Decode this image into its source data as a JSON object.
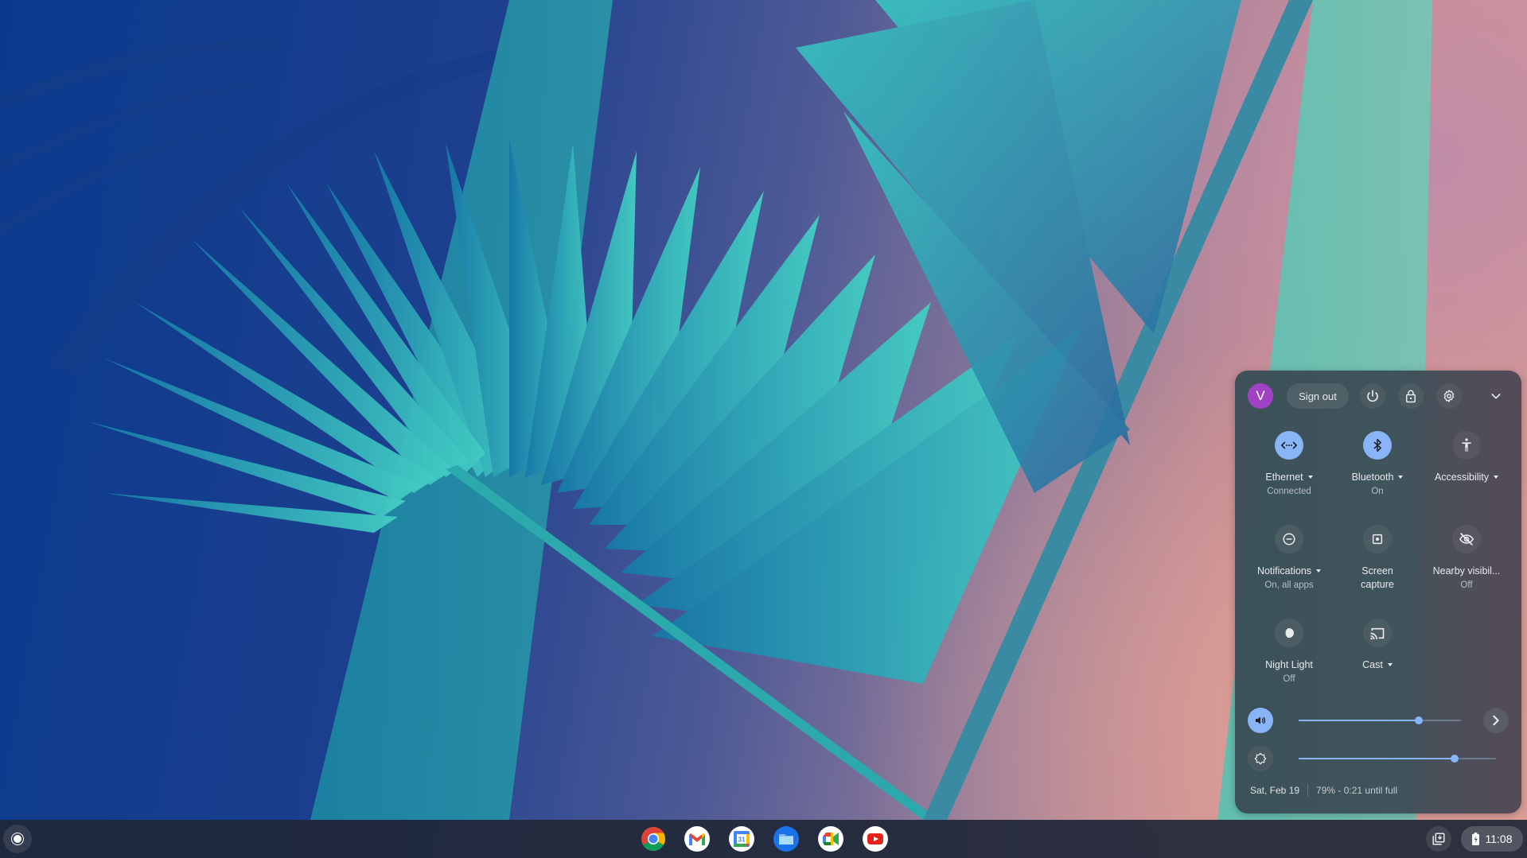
{
  "wallpaper": {
    "description": "palm-fronds",
    "colors": {
      "deep_blue": "#0a3a8e",
      "teal": "#3fc8c0",
      "pink": "#d99c95"
    }
  },
  "quick_settings": {
    "header": {
      "avatar_initial": "V",
      "avatar_color": "#a142c4",
      "sign_out_label": "Sign out",
      "icons": [
        "power-icon",
        "lock-icon",
        "settings-icon",
        "chevron-down-icon"
      ]
    },
    "tiles": [
      {
        "id": "ethernet",
        "label": "Ethernet",
        "sub": "Connected",
        "has_menu": true,
        "state": "on",
        "icon": "ethernet-icon"
      },
      {
        "id": "bluetooth",
        "label": "Bluetooth",
        "sub": "On",
        "has_menu": true,
        "state": "on",
        "icon": "bluetooth-icon"
      },
      {
        "id": "accessibility",
        "label": "Accessibility",
        "sub": "",
        "has_menu": true,
        "state": "off",
        "icon": "accessibility-icon"
      },
      {
        "id": "notifications",
        "label": "Notifications",
        "sub": "On, all apps",
        "has_menu": true,
        "state": "off",
        "icon": "do-not-disturb-icon"
      },
      {
        "id": "screen-capture",
        "label": "Screen",
        "label_line2": "capture",
        "sub": "",
        "has_menu": false,
        "state": "off",
        "icon": "screen-capture-icon"
      },
      {
        "id": "nearby",
        "label": "Nearby visibil...",
        "sub": "Off",
        "has_menu": false,
        "state": "off",
        "icon": "visibility-off-icon"
      },
      {
        "id": "night-light",
        "label": "Night Light",
        "sub": "Off",
        "has_menu": false,
        "state": "off",
        "icon": "night-light-icon"
      },
      {
        "id": "cast",
        "label": "Cast",
        "sub": "",
        "has_menu": true,
        "state": "off",
        "icon": "cast-icon"
      }
    ],
    "volume": {
      "level_percent": 74,
      "icon": "volume-icon"
    },
    "brightness": {
      "level_percent": 79,
      "icon": "brightness-icon"
    },
    "footer": {
      "date": "Sat, Feb 19",
      "battery": "79% - 0:21 until full"
    },
    "accent_color": "#8ab4f8"
  },
  "shelf": {
    "launcher_icon": "launcher-icon",
    "apps": [
      {
        "name": "Chrome",
        "icon": "chrome-icon"
      },
      {
        "name": "Gmail",
        "icon": "gmail-icon"
      },
      {
        "name": "Calendar",
        "icon": "calendar-icon",
        "badge": "31"
      },
      {
        "name": "Files",
        "icon": "files-icon"
      },
      {
        "name": "Meet",
        "icon": "meet-icon"
      },
      {
        "name": "YouTube",
        "icon": "youtube-icon"
      }
    ],
    "tray": {
      "time": "11:08",
      "holding_space_icon": "holding-space-icon",
      "battery_icon": "battery-charging-icon"
    }
  }
}
